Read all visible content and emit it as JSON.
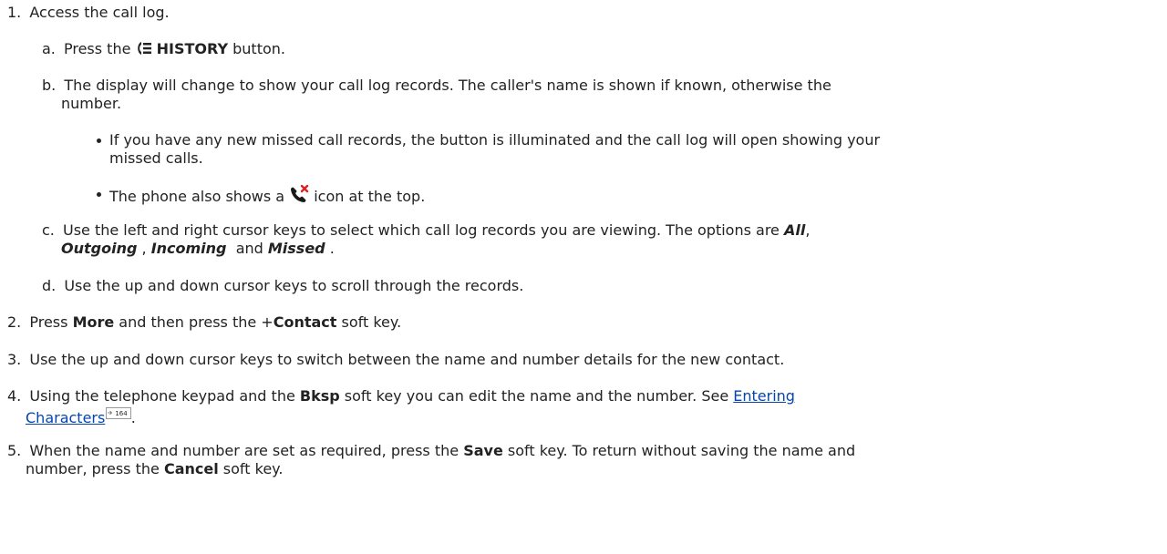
{
  "steps": [
    {
      "num": "1.",
      "text": "Access the call log."
    },
    {
      "num": "2.",
      "pre": "Press ",
      "more": "More",
      "mid": " and then press the +",
      "contact": "Contact",
      "post": " soft key."
    },
    {
      "num": "3.",
      "text": "Use the up and down cursor keys to switch between the name and number details for the new contact."
    },
    {
      "num": "4.",
      "pre": "Using the telephone keypad and the ",
      "bksp": "Bksp",
      "mid": " soft key you can edit the name and the number. See ",
      "link_part1": "Entering",
      "link_part2": "Characters",
      "xref_page": "164",
      "post": "."
    },
    {
      "num": "5.",
      "pre": "When the name and number are set as required, press the ",
      "save": "Save",
      "mid": " soft key. To return without saving the name and",
      "line2_pre": "number, press the ",
      "cancel": "Cancel",
      "line2_post": " soft key."
    }
  ],
  "substeps": [
    {
      "letter": "a.",
      "pre": "Press the ",
      "button": "HISTORY",
      "post": " button.",
      "icon": "history-icon"
    },
    {
      "letter": "b.",
      "line1": "The display will change to show your call log records. The caller's name is shown if known, otherwise the",
      "line2": "number."
    },
    {
      "letter": "c.",
      "line1": "Use the left and right cursor keys to select which call log records you are viewing. The options are ",
      "all": "All",
      "comma1": ",",
      "outgoing": "Outgoing",
      "comma2": " , ",
      "incoming": "Incoming",
      "and": "  and ",
      "missed": "Missed",
      "end": " ."
    },
    {
      "letter": "d.",
      "text": "Use the up and down cursor keys to scroll through the records."
    }
  ],
  "bullets": [
    {
      "line1": "If you have any new missed call records, the button is illuminated and the call log will open showing your",
      "line2": "missed calls."
    },
    {
      "pre": "The phone also shows a ",
      "icon": "missed-call-icon",
      "post": " icon at the top."
    }
  ],
  "colors": {
    "text": "#222222",
    "link": "#0645ad",
    "missed_x": "#e02020"
  }
}
